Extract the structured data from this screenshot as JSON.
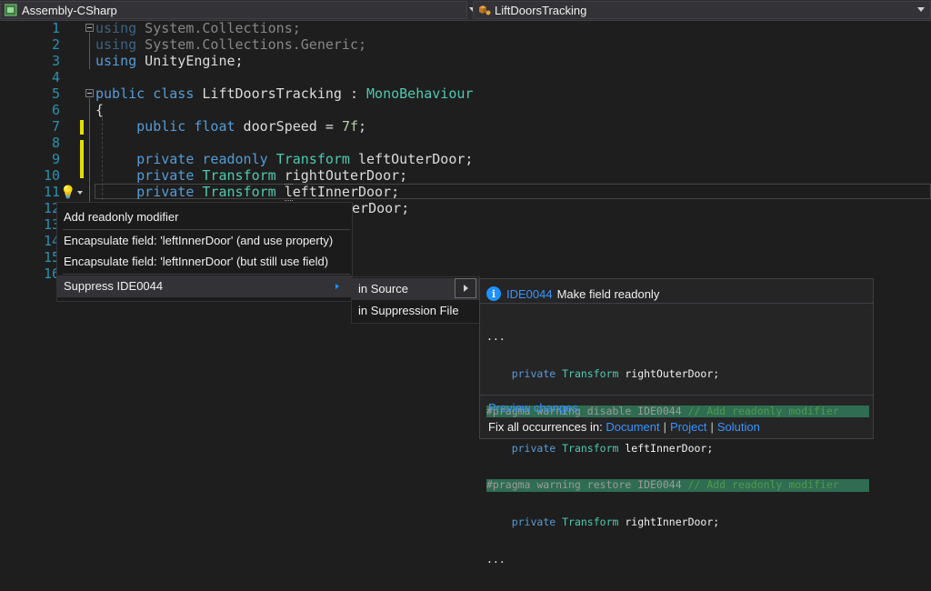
{
  "navbar": {
    "project": "Assembly-CSharp",
    "class": "LiftDoorsTracking"
  },
  "editor": {
    "line_numbers": [
      "1",
      "2",
      "3",
      "4",
      "5",
      "6",
      "7",
      "8",
      "9",
      "10",
      "11",
      "12",
      "13",
      "14",
      "15",
      "16"
    ],
    "code": {
      "l1_kw": "using",
      "l1_rest": " System.Collections;",
      "l2_kw": "using",
      "l2_rest": " System.Collections.Generic;",
      "l3_kw": "using",
      "l3_rest": " UnityEngine;",
      "l5_kw": "public class",
      "l5_name": " LiftDoorsTracking : ",
      "l5_base": "MonoBehaviour",
      "l6": "{",
      "l7_kw": "public float",
      "l7_rest": " doorSpeed = ",
      "l7_num": "7f",
      "l7_end": ";",
      "l9_kw": "private readonly",
      "l9_type": "Transform",
      "l9_rest": " leftOuterDoor;",
      "l10_kw": "private",
      "l10_type": "Transform",
      "l10_r": "r",
      "l10_rest": "ightOuterDoor;",
      "l11_kw": "private",
      "l11_type": "Transform",
      "l11_l": "l",
      "l11_rest": "eftInnerDoor;",
      "l12_tail": "nerDoor;"
    }
  },
  "lightbulb_menu": {
    "items": [
      "Add readonly modifier",
      "Encapsulate field: 'leftInnerDoor' (and use property)",
      "Encapsulate field: 'leftInnerDoor' (but still use field)",
      "Suppress IDE0044"
    ]
  },
  "submenu": {
    "items": [
      "in Source",
      "in Suppression File"
    ]
  },
  "preview": {
    "rule_id": "IDE0044",
    "title": "Make field readonly",
    "code": {
      "ellipsis": "...",
      "p2_kw": "private",
      "p2_type": "Transform",
      "p2_rest": " rightOuterDoor;",
      "p3_pragma": "#pragma warning disable IDE0044",
      "p3_comment": " // Add readonly modifier",
      "p4_kw": "private",
      "p4_type": "Transform",
      "p4_rest": " leftInnerDoor;",
      "p5_pragma": "#pragma warning restore IDE0044",
      "p5_comment": " // Add readonly modifier",
      "p6_kw": "private",
      "p6_type": "Transform",
      "p6_rest": " rightInnerDoor;"
    },
    "preview_changes": "Preview changes",
    "fix_all_label": "Fix all occurrences in:",
    "fix_targets": [
      "Document",
      "Project",
      "Solution"
    ],
    "separator": "|"
  }
}
